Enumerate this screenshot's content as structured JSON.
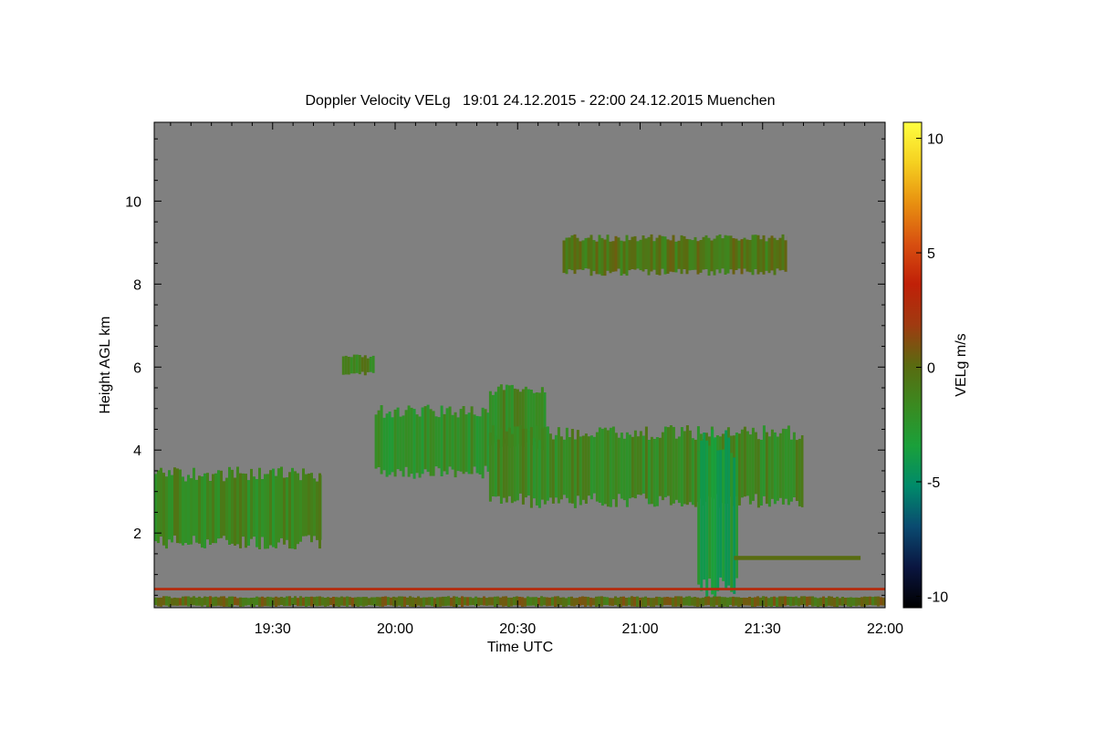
{
  "chart_data": {
    "type": "heatmap",
    "title": "Doppler Velocity VELg   19:01 24.12.2015 - 22:00 24.12.2015 Muenchen",
    "xlabel": "Time UTC",
    "ylabel": "Height AGL km",
    "colorbar_label": "VELg m/s",
    "x_range_minutes": [
      1141,
      1320
    ],
    "x_ticks": [
      {
        "minutes": 1170,
        "label": "19:30"
      },
      {
        "minutes": 1200,
        "label": "20:00"
      },
      {
        "minutes": 1230,
        "label": "20:30"
      },
      {
        "minutes": 1260,
        "label": "21:00"
      },
      {
        "minutes": 1290,
        "label": "21:30"
      },
      {
        "minutes": 1320,
        "label": "22:00"
      }
    ],
    "ylim": [
      0.2,
      11.9
    ],
    "y_ticks": [
      2,
      4,
      6,
      8,
      10
    ],
    "colorbar_range": [
      -10.5,
      10.7
    ],
    "colorbar_ticks": [
      10,
      5,
      0,
      -5,
      -10
    ],
    "background_color": "#808080",
    "colormap": [
      "#000000",
      "#0a1540",
      "#0a4a70",
      "#008a6a",
      "#1aa03a",
      "#3a8a20",
      "#5a6a10",
      "#a03a10",
      "#c02008",
      "#d85010",
      "#e89010",
      "#f5d020",
      "#ffff40"
    ],
    "echo_regions": [
      {
        "name": "low cloud left",
        "time_start": "19:01",
        "time_end": "19:42",
        "height_bottom_km": 1.6,
        "height_top_km": 3.6,
        "velocity_ms": -1.5
      },
      {
        "name": "mid cloud 20:00",
        "time_start": "19:55",
        "time_end": "20:23",
        "height_bottom_km": 3.3,
        "height_top_km": 5.1,
        "velocity_ms": -2
      },
      {
        "name": "small cloud 19:50",
        "time_start": "19:47",
        "time_end": "19:55",
        "height_bottom_km": 5.8,
        "height_top_km": 6.3,
        "velocity_ms": -1
      },
      {
        "name": "cloud 20:30",
        "time_start": "20:23",
        "time_end": "20:37",
        "height_bottom_km": 4.0,
        "height_top_km": 5.6,
        "velocity_ms": -1.5
      },
      {
        "name": "main cloud",
        "time_start": "20:23",
        "time_end": "21:40",
        "height_bottom_km": 2.6,
        "height_top_km": 4.6,
        "velocity_ms": -1.5
      },
      {
        "name": "precipitation fall streak",
        "time_start": "21:14",
        "time_end": "21:24",
        "height_bottom_km": 0.2,
        "height_top_km": 4.5,
        "velocity_ms": -3.5
      },
      {
        "name": "upper cloud",
        "time_start": "20:41",
        "time_end": "21:36",
        "height_bottom_km": 8.2,
        "height_top_km": 9.2,
        "velocity_ms": -0.5
      },
      {
        "name": "thin layer 1.4 km",
        "time_start": "21:23",
        "time_end": "21:54",
        "height_bottom_km": 1.35,
        "height_top_km": 1.45,
        "velocity_ms": 0
      },
      {
        "name": "near ground red line",
        "time_start": "19:01",
        "time_end": "22:00",
        "height_bottom_km": 0.62,
        "height_top_km": 0.68,
        "velocity_ms": 3
      },
      {
        "name": "near ground bands",
        "time_start": "19:01",
        "time_end": "22:00",
        "height_bottom_km": 0.22,
        "height_top_km": 0.48,
        "velocity_ms": 0
      }
    ]
  }
}
